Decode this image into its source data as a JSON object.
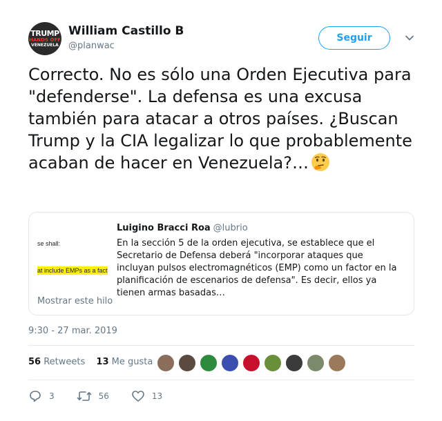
{
  "author": {
    "name": "William Castillo B",
    "handle": "@planwac",
    "avatar_text": [
      "TRUMP",
      "HANDS OFF",
      "VENEZUELA"
    ]
  },
  "follow_button": {
    "label": "Seguir"
  },
  "tweet": {
    "text": "Correcto. No es sólo una Orden Ejecutiva para \"defenderse\". La defensa es una excusa también para atacar a otros países. ¿Buscan Trump y la CIA legalizar lo que probablemente acaban de hacer en Venezuela?…",
    "emoji": "thinking-face"
  },
  "quoted_tweet": {
    "name": "Luigino Bracci Roa",
    "handle": "@lubrio",
    "text": "En la sección 5 de la orden ejecutiva, se establece que el Secretario de Defensa deberá \"incorporar ataques que incluyan pulsos electromagnéticos (EMP) como un factor en la planificación de escenarios de defensa\". Es decir, ellos ya tienen armas basadas…",
    "thumbnail_lines": [
      "se shall:",
      "at include EMPs as a fact"
    ],
    "show_thread": "Mostrar este hilo"
  },
  "timestamp": "9:30 - 27 mar. 2019",
  "stats": {
    "retweets_count": "56",
    "retweets_label": "Retweets",
    "likes_count": "13",
    "likes_label": "Me gusta"
  },
  "likers_colors": [
    "#8a6d5a",
    "#5a4a3f",
    "#2e8b3e",
    "#3a4fb0",
    "#c8102e",
    "#6a8f3a",
    "#3b3b3b",
    "#7a8a6a",
    "#9a7a5a"
  ],
  "actions": {
    "reply_count": "3",
    "retweet_count": "56",
    "like_count": "13"
  },
  "colors": {
    "accent": "#1da1f2",
    "secondary_text": "#657786"
  }
}
